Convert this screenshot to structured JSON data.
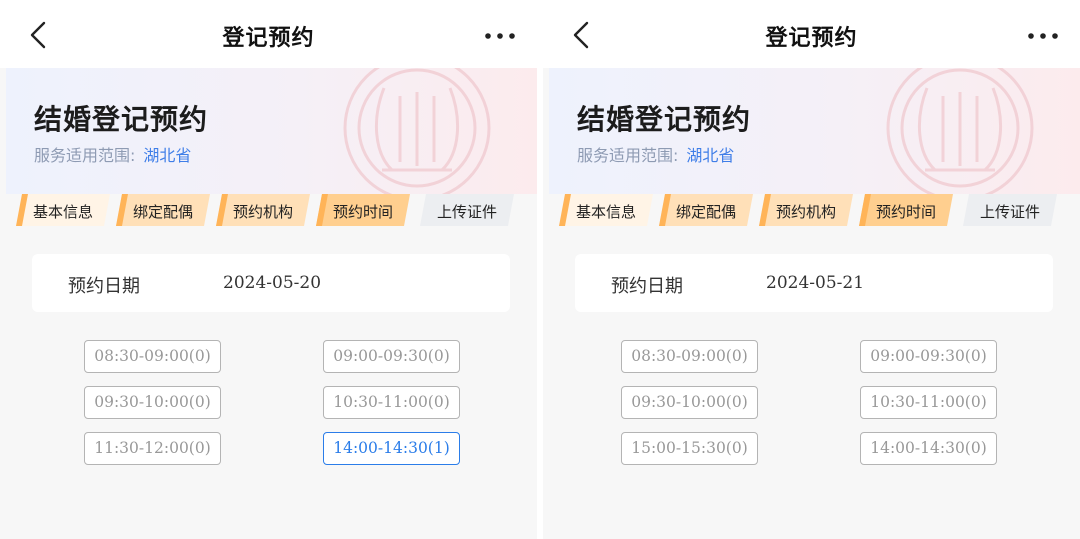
{
  "colors": {
    "accent_blue": "#2b7de9",
    "step_orange": "#ffcf8f",
    "step_gray": "#eceef1",
    "page_bg": "#f7f7f7"
  },
  "icons": {
    "back": "chevron-left-icon",
    "more": "more-dots-icon",
    "emblem": "marriage-emblem-icon"
  },
  "panels": [
    {
      "nav": {
        "title": "登记预约"
      },
      "header": {
        "title": "结婚登记预约",
        "scope_label": "服务适用范围:",
        "scope_value": "湖北省"
      },
      "steps": [
        {
          "label": "基本信息",
          "active": true
        },
        {
          "label": "绑定配偶",
          "active": true
        },
        {
          "label": "预约机构",
          "active": true
        },
        {
          "label": "预约时间",
          "active": true
        },
        {
          "label": "上传证件",
          "active": false
        }
      ],
      "date": {
        "label": "预约日期",
        "value": "2024-05-20"
      },
      "slots": [
        {
          "label": "08:30-09:00(0)",
          "selected": false
        },
        {
          "label": "09:00-09:30(0)",
          "selected": false
        },
        {
          "label": "09:30-10:00(0)",
          "selected": false
        },
        {
          "label": "10:30-11:00(0)",
          "selected": false
        },
        {
          "label": "11:30-12:00(0)",
          "selected": false
        },
        {
          "label": "14:00-14:30(1)",
          "selected": true
        }
      ]
    },
    {
      "nav": {
        "title": "登记预约"
      },
      "header": {
        "title": "结婚登记预约",
        "scope_label": "服务适用范围:",
        "scope_value": "湖北省"
      },
      "steps": [
        {
          "label": "基本信息",
          "active": true
        },
        {
          "label": "绑定配偶",
          "active": true
        },
        {
          "label": "预约机构",
          "active": true
        },
        {
          "label": "预约时间",
          "active": true
        },
        {
          "label": "上传证件",
          "active": false
        }
      ],
      "date": {
        "label": "预约日期",
        "value": "2024-05-21"
      },
      "slots": [
        {
          "label": "08:30-09:00(0)",
          "selected": false
        },
        {
          "label": "09:00-09:30(0)",
          "selected": false
        },
        {
          "label": "09:30-10:00(0)",
          "selected": false
        },
        {
          "label": "10:30-11:00(0)",
          "selected": false
        },
        {
          "label": "15:00-15:30(0)",
          "selected": false
        },
        {
          "label": "14:00-14:30(0)",
          "selected": false
        }
      ]
    }
  ]
}
